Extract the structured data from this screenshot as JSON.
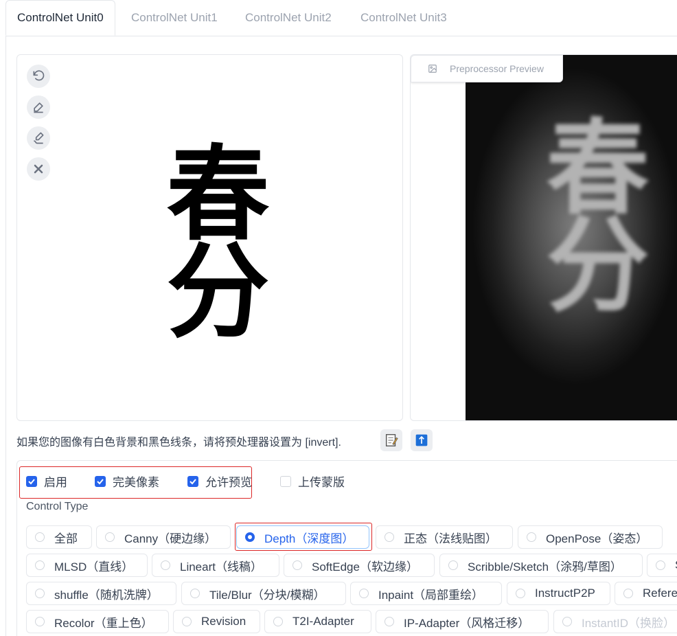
{
  "tabs": [
    "ControlNet Unit0",
    "ControlNet Unit1",
    "ControlNet Unit2",
    "ControlNet Unit3"
  ],
  "preview_label": "Preprocessor Preview",
  "hint_text": "如果您的图像有白色背景和黑色线条，请将预处理器设置为 [invert].",
  "checkboxes": {
    "enable": "启用",
    "pixel_perfect": "完美像素",
    "allow_preview": "允许预览",
    "upload_mask": "上传蒙版"
  },
  "control_type_label": "Control Type",
  "control_types": {
    "all": "全部",
    "canny": "Canny（硬边缘）",
    "depth": "Depth（深度图）",
    "normal": "正态（法线贴图）",
    "openpose": "OpenPose（姿态）",
    "mlsd": "MLSD（直线）",
    "lineart": "Lineart（线稿）",
    "softedge": "SoftEdge（软边缘）",
    "scribble": "Scribble/Sketch（涂鸦/草图）",
    "seg": "S",
    "shuffle": "shuffle（随机洗牌）",
    "tile": "Tile/Blur（分块/模糊）",
    "inpaint": "Inpaint（局部重绘）",
    "ip2p": "InstructP2P",
    "reference": "Refere",
    "recolor": "Recolor（重上色）",
    "revision": "Revision",
    "t2i": "T2I-Adapter",
    "ipadapter": "IP-Adapter（风格迁移）",
    "instantid": "InstantID（换脸）"
  },
  "image_text": "春分",
  "colors": {
    "accent": "#2563eb",
    "highlight": "#dc2626"
  }
}
